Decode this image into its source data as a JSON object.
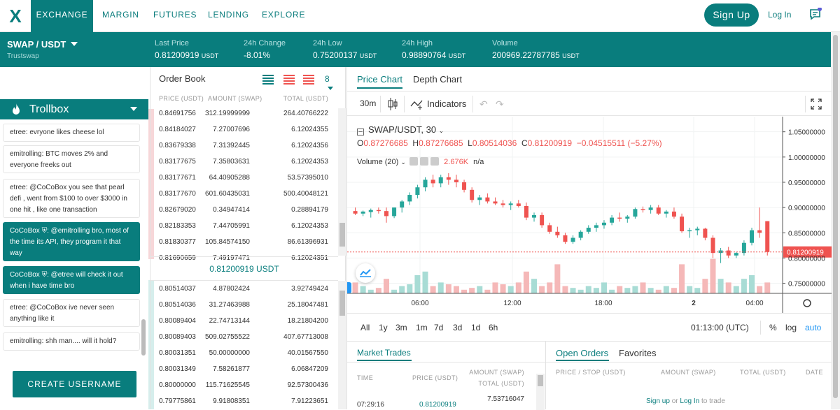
{
  "nav": {
    "logo": "X",
    "tabs": [
      "EXCHANGE",
      "MARGIN",
      "FUTURES",
      "LENDING",
      "EXPLORE"
    ],
    "signup": "Sign Up",
    "login": "Log In"
  },
  "ticker": {
    "pair": "SWAP / USDT",
    "sub": "Trustswap",
    "last_label": "Last Price",
    "last_value": "0.81200919",
    "last_unit": "USDT",
    "change_label": "24h Change",
    "change_value": "-8.01%",
    "low_label": "24h Low",
    "low_value": "0.75200137",
    "low_unit": "USDT",
    "high_label": "24h High",
    "high_value": "0.98890764",
    "high_unit": "USDT",
    "volume_label": "Volume",
    "volume_value": "200969.22787785",
    "volume_unit": "USDT"
  },
  "trollbox": {
    "title": "Trollbox",
    "messages": [
      {
        "text": "etree: evryone likes cheese lol",
        "mod": false
      },
      {
        "text": "emitrolling: BTC moves 2% and everyone freeks out",
        "mod": false
      },
      {
        "text": "etree: @CoCoBox you see that pearl defi , went from $100 to over $3000 in one hit , like one transaction",
        "mod": false
      },
      {
        "text": "CoCoBox ⛨: @emitrolling bro, most of the time its API, they program it that way",
        "mod": true
      },
      {
        "text": "CoCoBox ⛨: @etree will check it out when i have time bro",
        "mod": true
      },
      {
        "text": "etree: @CoCoBox ive never seen anything like it",
        "mod": false
      },
      {
        "text": "emitrolling: shh man.... will it hold?",
        "mod": false
      }
    ],
    "create": "CREATE USERNAME"
  },
  "orderbook": {
    "title": "Order Book",
    "depth": "8",
    "headers": {
      "price": "PRICE (USDT)",
      "amount": "AMOUNT (SWAP)",
      "total": "TOTAL (USDT)"
    },
    "asks": [
      [
        "0.84691756",
        "312.19999999",
        "264.40766222"
      ],
      [
        "0.84184027",
        "7.27007696",
        "6.12024355"
      ],
      [
        "0.83679338",
        "7.31392445",
        "6.12024356"
      ],
      [
        "0.83177675",
        "7.35803631",
        "6.12024353"
      ],
      [
        "0.83177671",
        "64.40905288",
        "53.57395010"
      ],
      [
        "0.83177670",
        "601.60435031",
        "500.40048121"
      ],
      [
        "0.82679020",
        "0.34947414",
        "0.28894179"
      ],
      [
        "0.82183353",
        "7.44705991",
        "6.12024353"
      ],
      [
        "0.81830377",
        "105.84574150",
        "86.61396931"
      ],
      [
        "0.81690659",
        "7.49197471",
        "6.12024351"
      ]
    ],
    "mid": "0.81200919 USDT",
    "bids": [
      [
        "0.80514037",
        "4.87802424",
        "3.92749424"
      ],
      [
        "0.80514036",
        "31.27463988",
        "25.18047481"
      ],
      [
        "0.80089404",
        "22.74713144",
        "18.21804200"
      ],
      [
        "0.80089403",
        "509.02755522",
        "407.67713008"
      ],
      [
        "0.80031351",
        "50.00000000",
        "40.01567550"
      ],
      [
        "0.80031349",
        "7.58261877",
        "6.06847209"
      ],
      [
        "0.80000000",
        "115.71625545",
        "92.57300436"
      ],
      [
        "0.79775861",
        "9.91808351",
        "7.91223651"
      ]
    ]
  },
  "chart": {
    "tab_price": "Price Chart",
    "tab_depth": "Depth Chart",
    "interval": "30m",
    "indicators": "Indicators",
    "symbol": "SWAP/USDT, 30",
    "ohlc": {
      "o": "0.87276685",
      "h": "0.87276685",
      "l": "0.80514036",
      "c": "0.81200919",
      "chg": "−0.04515511 (−5.27%)"
    },
    "volume_label": "Volume (20)",
    "volume_value": "2.676K",
    "volume_na": "n/a",
    "price_ticks": [
      "1.05000000",
      "1.00000000",
      "0.95000000",
      "0.90000000",
      "0.85000000",
      "0.80000000",
      "0.75000000"
    ],
    "current_price": "0.81200919",
    "time_ticks": [
      "06:00",
      "12:00",
      "18:00",
      "2",
      "04:00"
    ],
    "timeframes": [
      "All",
      "1y",
      "3m",
      "1m",
      "7d",
      "3d",
      "1d",
      "6h"
    ],
    "clock": "01:13:00 (UTC)",
    "pct": "%",
    "log": "log",
    "auto": "auto",
    "up_color": "#26a69a",
    "down_color": "#ef5350"
  },
  "market_trades": {
    "title": "Market Trades",
    "headers": {
      "time": "TIME",
      "price": "PRICE (USDT)",
      "amount": "AMOUNT (SWAP)",
      "total": "TOTAL (USDT)"
    },
    "rows": [
      [
        "07:29:16",
        "0.81200919",
        "7.53716047"
      ]
    ]
  },
  "open_orders": {
    "tab_open": "Open Orders",
    "tab_fav": "Favorites",
    "headers": {
      "price": "PRICE / STOP (USDT)",
      "amount": "AMOUNT (SWAP)",
      "total": "TOTAL (USDT)",
      "date": "DATE"
    },
    "signup": "Sign up",
    "or": "or",
    "login": "Log In",
    "to_trade": "to trade"
  }
}
